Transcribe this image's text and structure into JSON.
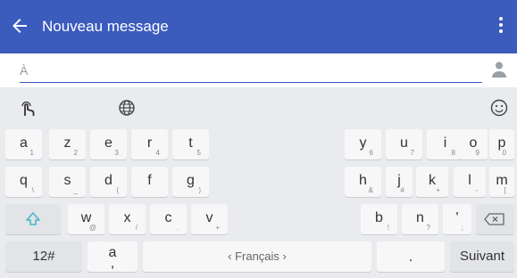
{
  "app_bar": {
    "title": "Nouveau message",
    "icons": {
      "back": "arrow-left-icon",
      "menu": "more-vert-icon"
    },
    "color": "#3b5bbd"
  },
  "recipient": {
    "placeholder": "À",
    "value": "",
    "icon": "person-icon"
  },
  "keyboard": {
    "tools": {
      "left": "gesture-icon",
      "middle": "globe-icon",
      "right": "emoji-icon"
    },
    "row1_left": [
      {
        "main": "a",
        "sub": "1"
      },
      {
        "main": "z",
        "sub": "2"
      },
      {
        "main": "e",
        "sub": "3"
      },
      {
        "main": "r",
        "sub": "4"
      },
      {
        "main": "t",
        "sub": "5"
      }
    ],
    "row1_right": [
      {
        "main": "y",
        "sub": "6"
      },
      {
        "main": "u",
        "sub": "7"
      },
      {
        "main": "i",
        "sub": "8"
      },
      {
        "main": "o",
        "sub": "9"
      },
      {
        "main": "p",
        "sub": "0"
      }
    ],
    "row2_left": [
      {
        "main": "q",
        "sub": "\\"
      },
      {
        "main": "s",
        "sub": "_"
      },
      {
        "main": "d",
        "sub": "("
      },
      {
        "main": "f",
        "sub": ""
      },
      {
        "main": "g",
        "sub": ")"
      }
    ],
    "row2_right": [
      {
        "main": "h",
        "sub": "&"
      },
      {
        "main": "j",
        "sub": "#"
      },
      {
        "main": "k",
        "sub": "+"
      },
      {
        "main": "l",
        "sub": "-"
      },
      {
        "main": "m",
        "sub": "["
      }
    ],
    "row3_left": [
      {
        "main": "w",
        "sub": "@"
      },
      {
        "main": "x",
        "sub": "/"
      },
      {
        "main": "c",
        "sub": "."
      },
      {
        "main": "v",
        "sub": "+"
      }
    ],
    "row3_right": [
      {
        "main": "b",
        "sub": "!"
      },
      {
        "main": "n",
        "sub": "?"
      },
      {
        "main": "'",
        "sub": ";"
      }
    ],
    "bottom": {
      "symbols_label": "12#",
      "comma_main": "a",
      "comma_sub": ",",
      "space_label": "‹ Français ›",
      "period_main": ".",
      "enter_label": "Suivant"
    }
  }
}
